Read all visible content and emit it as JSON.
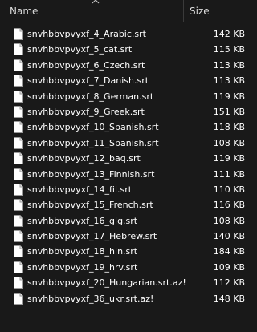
{
  "header": {
    "name_label": "Name",
    "size_label": "Size",
    "sort_icon": "chevron-up-icon"
  },
  "files": [
    {
      "name": "snvhbbvpvyxf_4_Arabic.srt",
      "size": "142 KB"
    },
    {
      "name": "snvhbbvpvyxf_5_cat.srt",
      "size": "115 KB"
    },
    {
      "name": "snvhbbvpvyxf_6_Czech.srt",
      "size": "113 KB"
    },
    {
      "name": "snvhbbvpvyxf_7_Danish.srt",
      "size": "113 KB"
    },
    {
      "name": "snvhbbvpvyxf_8_German.srt",
      "size": "119 KB"
    },
    {
      "name": "snvhbbvpvyxf_9_Greek.srt",
      "size": "151 KB"
    },
    {
      "name": "snvhbbvpvyxf_10_Spanish.srt",
      "size": "118 KB"
    },
    {
      "name": "snvhbbvpvyxf_11_Spanish.srt",
      "size": "108 KB"
    },
    {
      "name": "snvhbbvpvyxf_12_baq.srt",
      "size": "119 KB"
    },
    {
      "name": "snvhbbvpvyxf_13_Finnish.srt",
      "size": "111 KB"
    },
    {
      "name": "snvhbbvpvyxf_14_fil.srt",
      "size": "110 KB"
    },
    {
      "name": "snvhbbvpvyxf_15_French.srt",
      "size": "116 KB"
    },
    {
      "name": "snvhbbvpvyxf_16_glg.srt",
      "size": "108 KB"
    },
    {
      "name": "snvhbbvpvyxf_17_Hebrew.srt",
      "size": "140 KB"
    },
    {
      "name": "snvhbbvpvyxf_18_hin.srt",
      "size": "184 KB"
    },
    {
      "name": "snvhbbvpvyxf_19_hrv.srt",
      "size": "109 KB"
    },
    {
      "name": "snvhbbvpvyxf_20_Hungarian.srt.az!",
      "size": "112 KB"
    },
    {
      "name": "snvhbbvpvyxf_36_ukr.srt.az!",
      "size": "148 KB"
    }
  ],
  "file_icon": "document-icon"
}
